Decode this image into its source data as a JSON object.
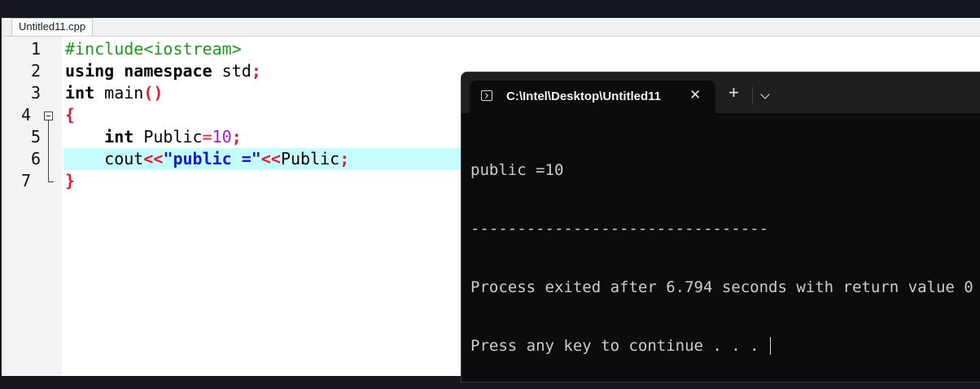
{
  "editor": {
    "tab_label": "Untitled11.cpp",
    "line_numbers": [
      "1",
      "2",
      "3",
      "4",
      "5",
      "6",
      "7"
    ],
    "lines": {
      "l1": {
        "text": "#include<iostream>"
      },
      "l2": {
        "kw1": "using",
        "kw2": "namespace",
        "rest": " std",
        "semi": ";"
      },
      "l3": {
        "kw": "int",
        "rest": " main",
        "paren": "()"
      },
      "l4": {
        "brace": "{"
      },
      "l5": {
        "indent": "    ",
        "kw": "int",
        "var": " Public",
        "eq": "=",
        "num": "10",
        "semi": ";"
      },
      "l6": {
        "indent": "    ",
        "cout": "cout",
        "op1": "<<",
        "str": "\"public =\"",
        "op2": "<<",
        "var": "Public",
        "semi": ";"
      },
      "l7": {
        "brace": "}"
      }
    }
  },
  "terminal": {
    "tab_title": "C:\\Intel\\Desktop\\Untitled11",
    "close_glyph": "✕",
    "new_tab_glyph": "+",
    "output": [
      "public =10",
      "--------------------------------",
      "Process exited after 6.794 seconds with return value 0",
      "Press any key to continue . . . "
    ]
  },
  "colors": {
    "preprocessor": "#1a9a1a",
    "operator": "#e8192c",
    "number": "#a020d0",
    "string": "#1818d8",
    "active_line": "#c4fbfb",
    "terminal_bg": "#0c0c0c"
  }
}
